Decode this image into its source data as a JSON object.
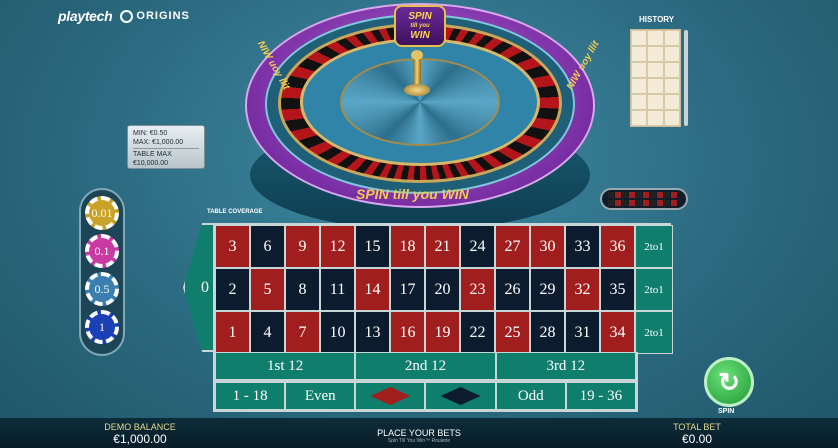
{
  "branding": {
    "brand1": "playtech",
    "brand2": "ORIGINS"
  },
  "limits": {
    "min": "MIN: €0.50",
    "max": "MAX: €1,000.00",
    "table_max_label": "TABLE MAX",
    "table_max_value": "€10,000.00"
  },
  "history": {
    "title": "HISTORY"
  },
  "wheel": {
    "brand_top_line1": "SPIN",
    "brand_top_line2": "till you",
    "brand_top_line3": "WIN",
    "rim_text": "SPIN till you WIN",
    "rim_side_left": "NIW uoy llit",
    "rim_side_right": "NIW uoy llit"
  },
  "chips": [
    {
      "value": "0.01",
      "color": "#c9a227"
    },
    {
      "value": "0.1",
      "color": "#c93aa2"
    },
    {
      "value": "0.5",
      "color": "#3a7fb0"
    },
    {
      "value": "1",
      "color": "#1b3fb5"
    }
  ],
  "table": {
    "coverage_label": "TABLE COVERAGE",
    "zero": "0",
    "rows": [
      [
        {
          "n": "3",
          "c": "red"
        },
        {
          "n": "6",
          "c": "black"
        },
        {
          "n": "9",
          "c": "red"
        },
        {
          "n": "12",
          "c": "red"
        },
        {
          "n": "15",
          "c": "black"
        },
        {
          "n": "18",
          "c": "red"
        },
        {
          "n": "21",
          "c": "red"
        },
        {
          "n": "24",
          "c": "black"
        },
        {
          "n": "27",
          "c": "red"
        },
        {
          "n": "30",
          "c": "red"
        },
        {
          "n": "33",
          "c": "black"
        },
        {
          "n": "36",
          "c": "red"
        }
      ],
      [
        {
          "n": "2",
          "c": "black"
        },
        {
          "n": "5",
          "c": "red"
        },
        {
          "n": "8",
          "c": "black"
        },
        {
          "n": "11",
          "c": "black"
        },
        {
          "n": "14",
          "c": "red"
        },
        {
          "n": "17",
          "c": "black"
        },
        {
          "n": "20",
          "c": "black"
        },
        {
          "n": "23",
          "c": "red"
        },
        {
          "n": "26",
          "c": "black"
        },
        {
          "n": "29",
          "c": "black"
        },
        {
          "n": "32",
          "c": "red"
        },
        {
          "n": "35",
          "c": "black"
        }
      ],
      [
        {
          "n": "1",
          "c": "red"
        },
        {
          "n": "4",
          "c": "black"
        },
        {
          "n": "7",
          "c": "red"
        },
        {
          "n": "10",
          "c": "black"
        },
        {
          "n": "13",
          "c": "black"
        },
        {
          "n": "16",
          "c": "red"
        },
        {
          "n": "19",
          "c": "red"
        },
        {
          "n": "22",
          "c": "black"
        },
        {
          "n": "25",
          "c": "red"
        },
        {
          "n": "28",
          "c": "black"
        },
        {
          "n": "31",
          "c": "black"
        },
        {
          "n": "34",
          "c": "red"
        }
      ]
    ],
    "column_bet_label": "2to1",
    "dozens": [
      "1st 12",
      "2nd 12",
      "3rd 12"
    ],
    "outside": {
      "low": "1 - 18",
      "even": "Even",
      "odd": "Odd",
      "high": "19 - 36"
    },
    "colors": {
      "red": "#a01e1e",
      "black": "#0d1b2e",
      "felt": "#0f7e6d"
    }
  },
  "spin": {
    "label": "SPIN"
  },
  "footer": {
    "balance_label": "DEMO BALANCE",
    "balance_value": "€1,000.00",
    "status": "PLACE YOUR BETS",
    "game_name": "Spin Till You Win™ Roulette",
    "total_bet_label": "TOTAL BET",
    "total_bet_value": "€0.00"
  }
}
